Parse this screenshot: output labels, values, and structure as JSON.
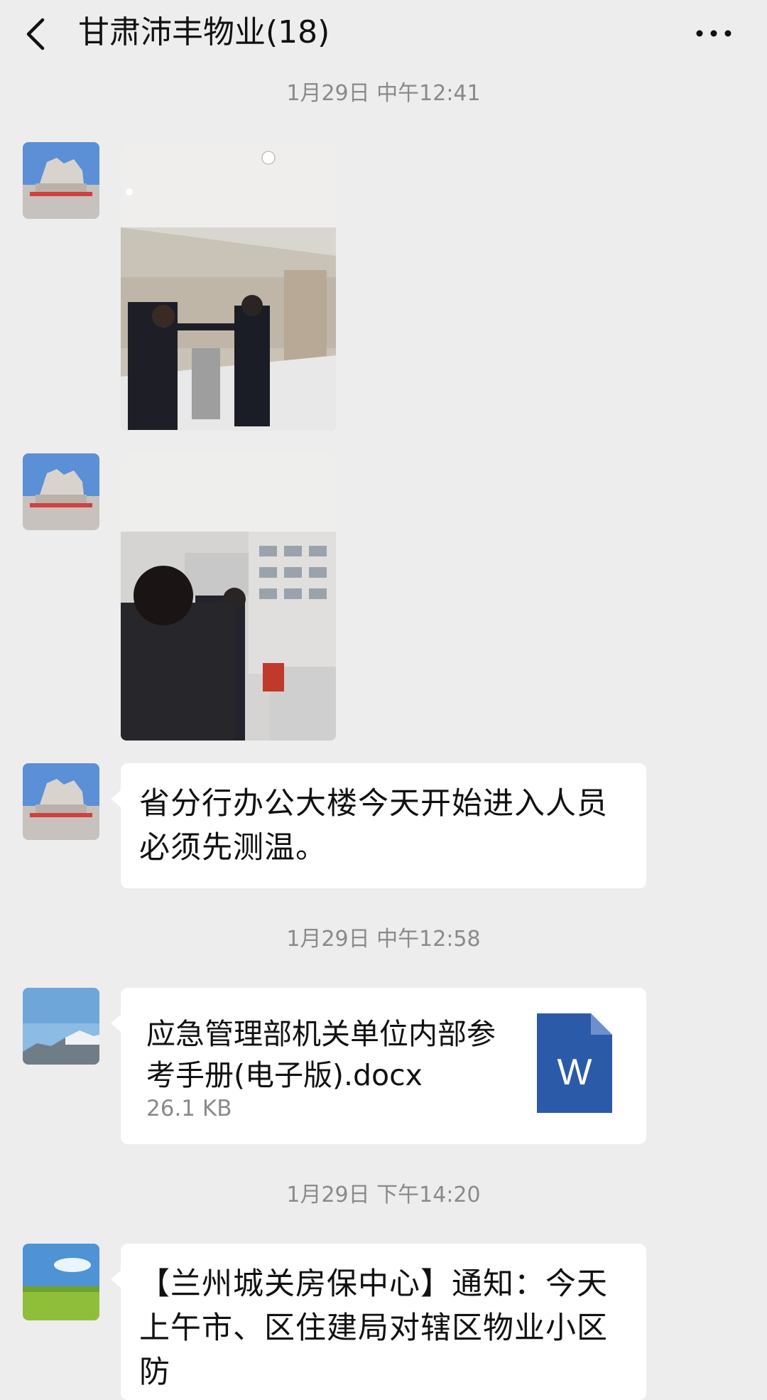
{
  "header": {
    "title": "甘肃沛丰物业(18)",
    "back_icon": "chevron-left-icon",
    "more_icon": "more-dots-icon"
  },
  "messages": [
    {
      "type": "timestamp",
      "text": "1月29日 中午12:41"
    },
    {
      "type": "image",
      "description": "photo"
    },
    {
      "type": "image",
      "description": "photo"
    },
    {
      "type": "text",
      "text": "省分行办公大楼今天开始进入人员必须先测温。"
    },
    {
      "type": "timestamp",
      "text": "1月29日 中午12:58"
    },
    {
      "type": "file",
      "name": "应急管理部机关单位内部参考手册(电子版).docx",
      "size": "26.1 KB",
      "icon": "word-doc-icon",
      "icon_letter": "W"
    },
    {
      "type": "timestamp",
      "text": "1月29日 下午14:20"
    },
    {
      "type": "text",
      "text": "【兰州城关房保中心】通知：今天上午市、区住建局对辖区物业小区防"
    }
  ],
  "colors": {
    "background": "#ededed",
    "bubble": "#ffffff",
    "timestamp": "#8a8a8a",
    "word_icon": "#2b5aa8"
  }
}
